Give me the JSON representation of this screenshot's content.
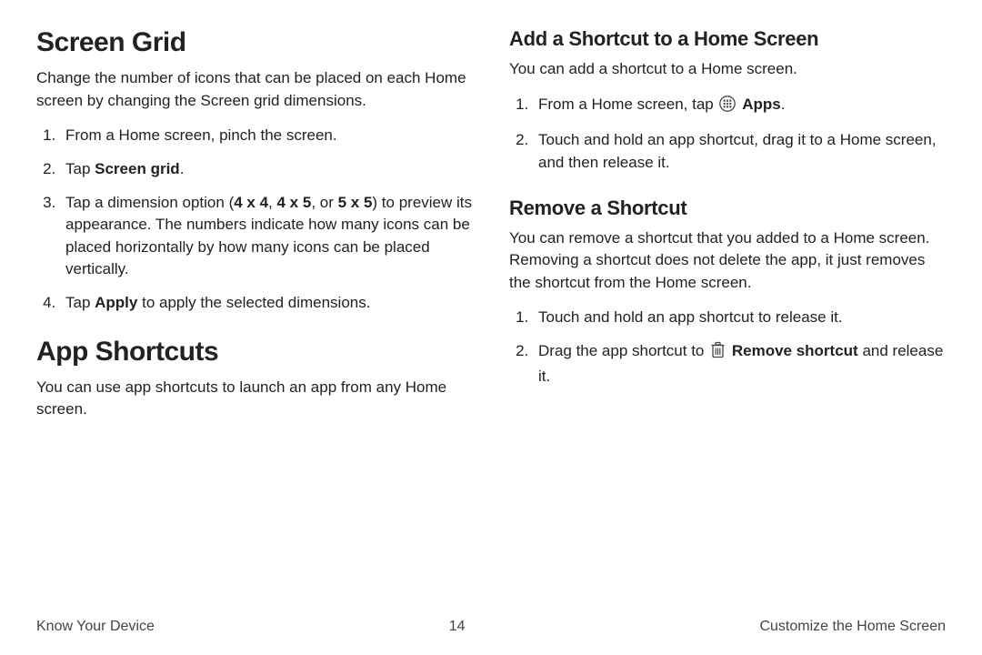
{
  "left": {
    "h1": "Screen Grid",
    "intro": "Change the number of icons that can be placed on each Home screen by changing the Screen grid dimensions.",
    "steps": {
      "s1": "From a Home screen, pinch the screen.",
      "s2": {
        "pre": "Tap ",
        "bold": "Screen grid",
        "post": "."
      },
      "s3": {
        "pre": "Tap a dimension option (",
        "b1": "4 x 4",
        "sep1": ", ",
        "b2": "4 x 5",
        "sep2": ", or ",
        "b3": "5 x 5",
        "post": ") to preview its appearance. The numbers indicate how many icons can be placed horizontally by how many icons can be placed vertically."
      },
      "s4": {
        "pre": "Tap ",
        "bold": "Apply",
        "post": " to apply the selected dimensions."
      }
    },
    "h1b": "App Shortcuts",
    "p2": "You can use app shortcuts to launch an app from any Home screen."
  },
  "right": {
    "h2a": "Add a Shortcut to a Home Screen",
    "p1": "You can add a shortcut to a Home screen.",
    "steps_a": {
      "s1": {
        "pre": "From a Home screen, tap ",
        "icon": "apps-icon",
        "bold": "Apps",
        "post": "."
      },
      "s2": "Touch and hold an app shortcut, drag it to a Home screen, and then release it."
    },
    "h2b": "Remove a Shortcut",
    "p2": "You can remove a shortcut that you added to a Home screen. Removing a shortcut does not delete the app, it just removes the shortcut from the Home screen.",
    "steps_b": {
      "s1": "Touch and hold an app shortcut to release it.",
      "s2": {
        "pre": "Drag the app shortcut to ",
        "icon": "trash-icon",
        "bold": "Remove shortcut",
        "post": " and release it."
      }
    }
  },
  "footer": {
    "left": "Know Your Device",
    "page": "14",
    "right": "Customize the Home Screen"
  }
}
